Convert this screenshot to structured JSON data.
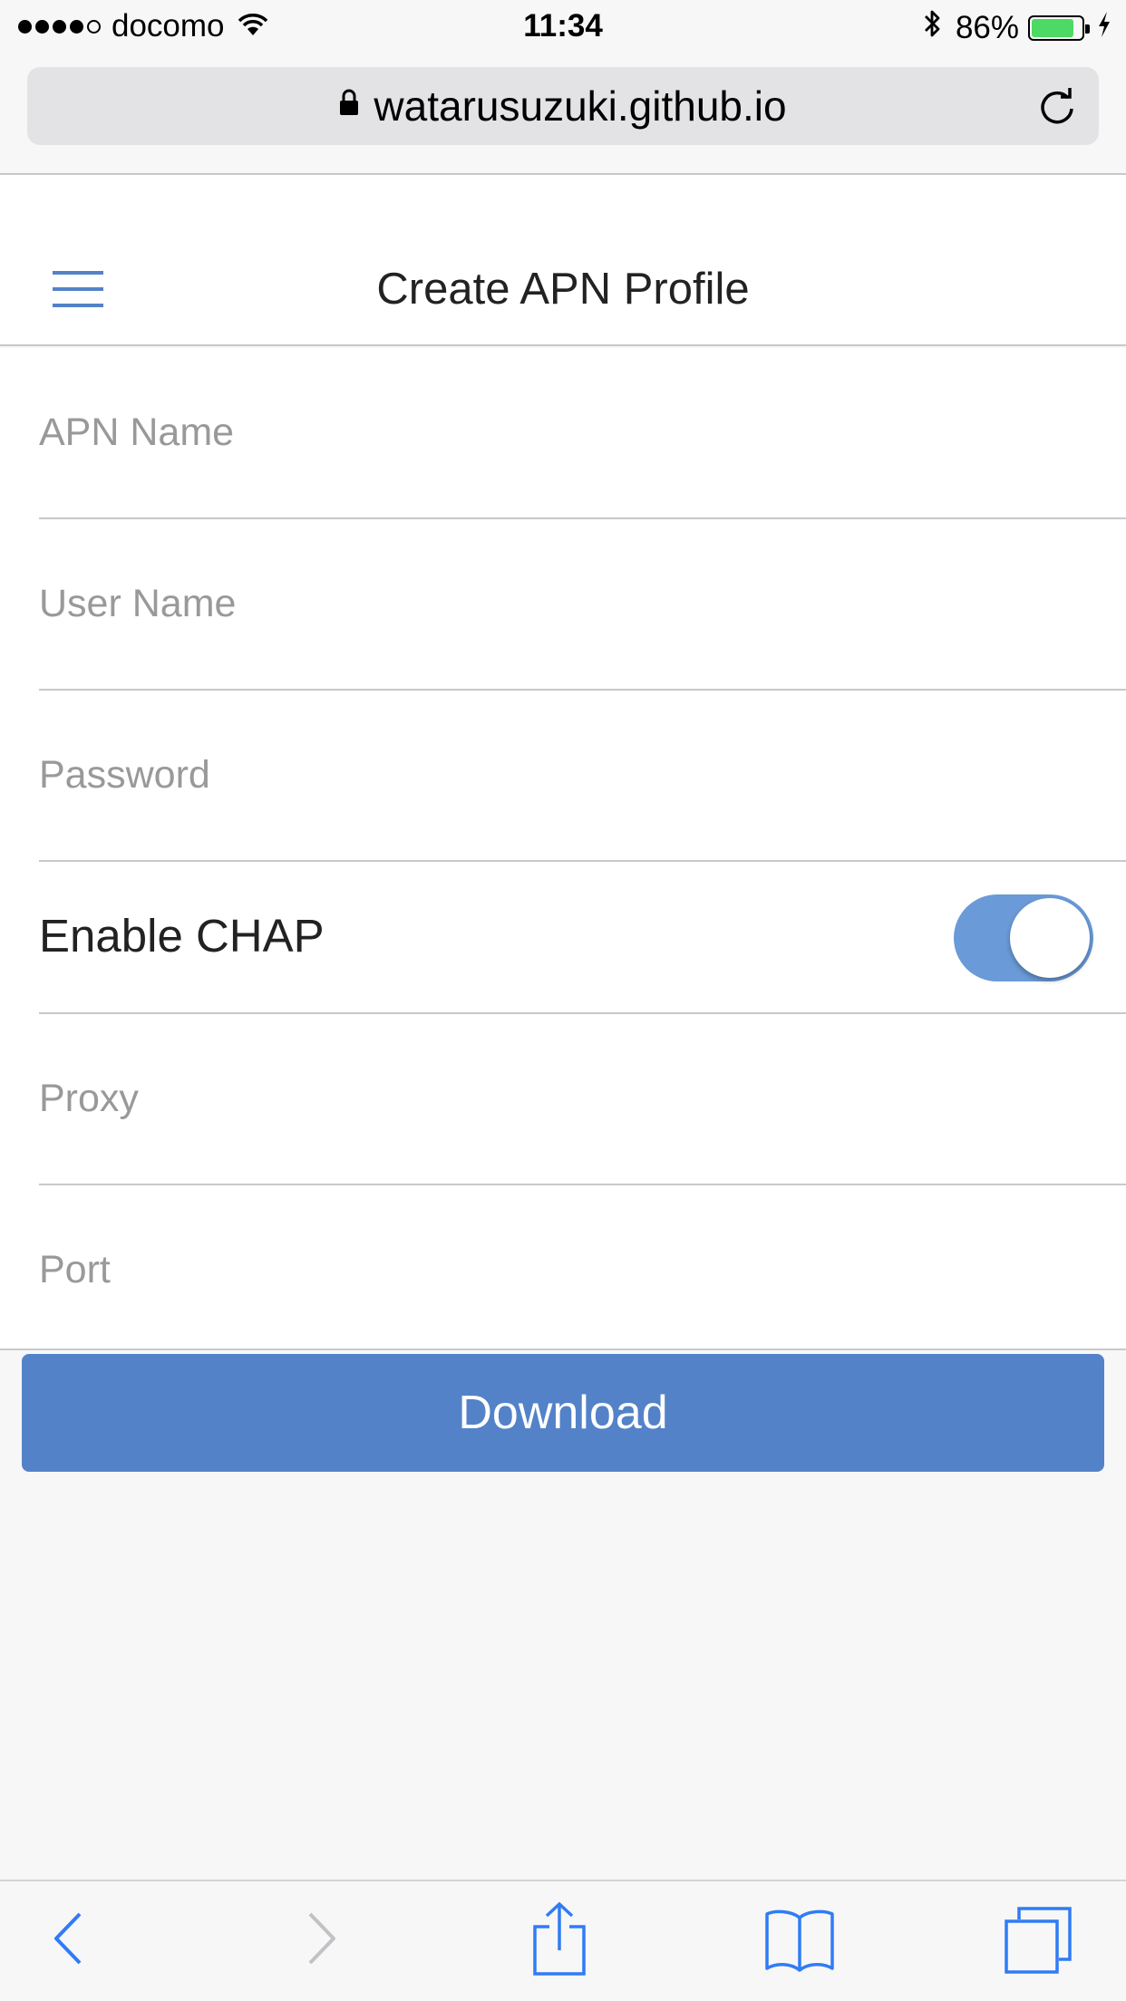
{
  "status_bar": {
    "carrier": "docomo",
    "time": "11:34",
    "battery_percent": "86%",
    "battery_level": 0.86,
    "signal_bars_filled": 4,
    "signal_bars_total": 5
  },
  "browser": {
    "url": "watarusuzuki.github.io"
  },
  "header": {
    "title": "Create APN Profile"
  },
  "form": {
    "apn_name": {
      "placeholder": "APN Name",
      "value": ""
    },
    "user_name": {
      "placeholder": "User Name",
      "value": ""
    },
    "password": {
      "placeholder": "Password",
      "value": ""
    },
    "chap": {
      "label": "Enable CHAP",
      "enabled": true
    },
    "proxy": {
      "placeholder": "Proxy",
      "value": ""
    },
    "port": {
      "placeholder": "Port",
      "value": ""
    }
  },
  "actions": {
    "download_label": "Download"
  },
  "toolbar": {
    "icons": [
      "back-icon",
      "forward-icon",
      "share-icon",
      "bookmarks-icon",
      "tabs-icon"
    ]
  },
  "colors": {
    "accent": "#5382c8",
    "toggle_on": "#6a9ad8",
    "ios_blue": "#2f7cf6",
    "battery_green": "#4cd964"
  }
}
